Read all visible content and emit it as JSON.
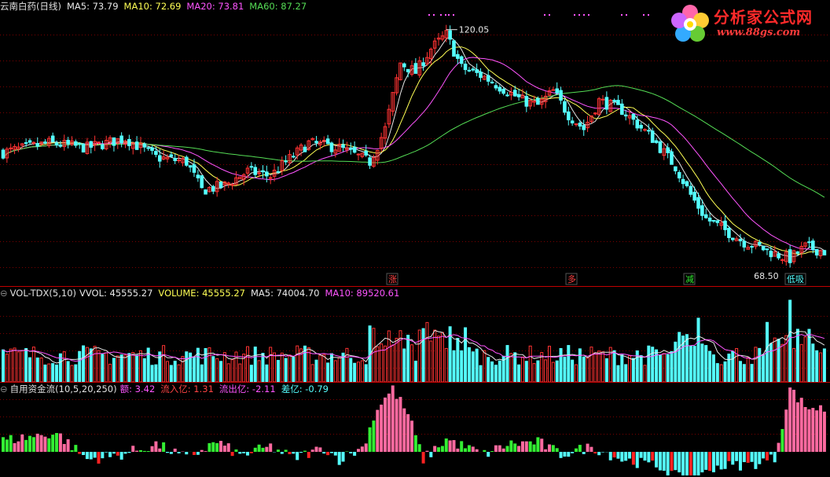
{
  "stock": {
    "title": "云南白药(日线)",
    "ma": [
      {
        "label": "MA5: 73.79",
        "color": "#e8e8e8"
      },
      {
        "label": "MA10: 72.69",
        "color": "#ffff55"
      },
      {
        "label": "MA20: 73.81",
        "color": "#ff55ff"
      },
      {
        "label": "MA60: 87.27",
        "color": "#55dd55"
      }
    ]
  },
  "volume": {
    "indicator": "VOL-TDX(5,10)",
    "items": [
      {
        "label": "VVOL: 45555.27",
        "color": "#e8e8e8"
      },
      {
        "label": "VOLUME: 45555.27",
        "color": "#ffff55"
      },
      {
        "label": "MA5: 74004.70",
        "color": "#e8e8e8"
      },
      {
        "label": "MA10: 89520.61",
        "color": "#ff55ff"
      }
    ]
  },
  "flow": {
    "indicator": "自用资金流(10,5,20,250)",
    "items": [
      {
        "label": "额: 3.42",
        "color": "#ff55ff"
      },
      {
        "label": "流入亿: 1.31",
        "color": "#ff4444"
      },
      {
        "label": "流出亿: -2.11",
        "color": "#ff55ff"
      },
      {
        "label": "差亿: -0.79",
        "color": "#55ffff"
      }
    ]
  },
  "logo": {
    "text": "分析家公式网",
    "url": "www.88gs.com"
  },
  "colors": {
    "up": "#ff3333",
    "down": "#54ffff",
    "flow_up": "#ff6aa0",
    "flow_mid": "#33ee33",
    "grid": "#7a0000",
    "sep": "#aa0000"
  },
  "chart_data": {
    "type": "candlestick",
    "series": [
      {
        "name": "MA5",
        "color": "#e8e8e8"
      },
      {
        "name": "MA10",
        "color": "#ffff55"
      },
      {
        "name": "MA20",
        "color": "#ff55ff"
      },
      {
        "name": "MA60",
        "color": "#55dd55"
      }
    ],
    "annotations": [
      {
        "label": "120.05",
        "price": 120.05,
        "type": "high"
      },
      {
        "label": "68.50",
        "price": 68.5,
        "type": "low"
      }
    ],
    "event_markers": [
      {
        "label": "涨",
        "color": "#ff4444"
      },
      {
        "label": "多",
        "color": "#ff4444"
      },
      {
        "label": "减",
        "color": "#33ee33"
      },
      {
        "label": "低吸",
        "color": "#55ffff"
      }
    ],
    "ylim": [
      66,
      123
    ],
    "close_path": [
      [
        0,
        93
      ],
      [
        12,
        95
      ],
      [
        22,
        94
      ],
      [
        32,
        96
      ],
      [
        40,
        92
      ],
      [
        48,
        91
      ],
      [
        52,
        85
      ],
      [
        58,
        86
      ],
      [
        64,
        89
      ],
      [
        70,
        88
      ],
      [
        74,
        91
      ],
      [
        80,
        95
      ],
      [
        88,
        94
      ],
      [
        96,
        91
      ],
      [
        100,
        98
      ],
      [
        104,
        112
      ],
      [
        108,
        110
      ],
      [
        112,
        115
      ],
      [
        116,
        118
      ],
      [
        120,
        111
      ],
      [
        126,
        109
      ],
      [
        130,
        107
      ],
      [
        136,
        104
      ],
      [
        140,
        103
      ],
      [
        144,
        106
      ],
      [
        148,
        101
      ],
      [
        152,
        98
      ],
      [
        156,
        104
      ],
      [
        162,
        102
      ],
      [
        170,
        96
      ],
      [
        176,
        90
      ],
      [
        180,
        84
      ],
      [
        184,
        79
      ],
      [
        188,
        77
      ],
      [
        194,
        74
      ],
      [
        198,
        73
      ],
      [
        202,
        71.5
      ],
      [
        206,
        70.5
      ],
      [
        210,
        73
      ],
      [
        215,
        72
      ]
    ],
    "flow_path": [
      [
        0,
        0.9
      ],
      [
        14,
        1.5
      ],
      [
        22,
        -0.6
      ],
      [
        30,
        -0.3
      ],
      [
        40,
        0.6
      ],
      [
        48,
        -0.5
      ],
      [
        56,
        0.8
      ],
      [
        62,
        -0.3
      ],
      [
        70,
        0.4
      ],
      [
        76,
        -0.5
      ],
      [
        84,
        0.3
      ],
      [
        88,
        -0.6
      ],
      [
        94,
        0.3
      ],
      [
        98,
        3.5
      ],
      [
        102,
        5.0
      ],
      [
        106,
        3.0
      ],
      [
        110,
        -0.6
      ],
      [
        116,
        1.0
      ],
      [
        120,
        0.5
      ],
      [
        126,
        -0.2
      ],
      [
        132,
        0.6
      ],
      [
        140,
        0.8
      ],
      [
        146,
        -0.2
      ],
      [
        154,
        0.4
      ],
      [
        162,
        -0.6
      ],
      [
        172,
        -1.2
      ],
      [
        180,
        -2.6
      ],
      [
        186,
        -1.2
      ],
      [
        196,
        -1.0
      ],
      [
        202,
        -0.5
      ],
      [
        206,
        5.0
      ],
      [
        210,
        3.6
      ],
      [
        215,
        3.4
      ]
    ]
  }
}
